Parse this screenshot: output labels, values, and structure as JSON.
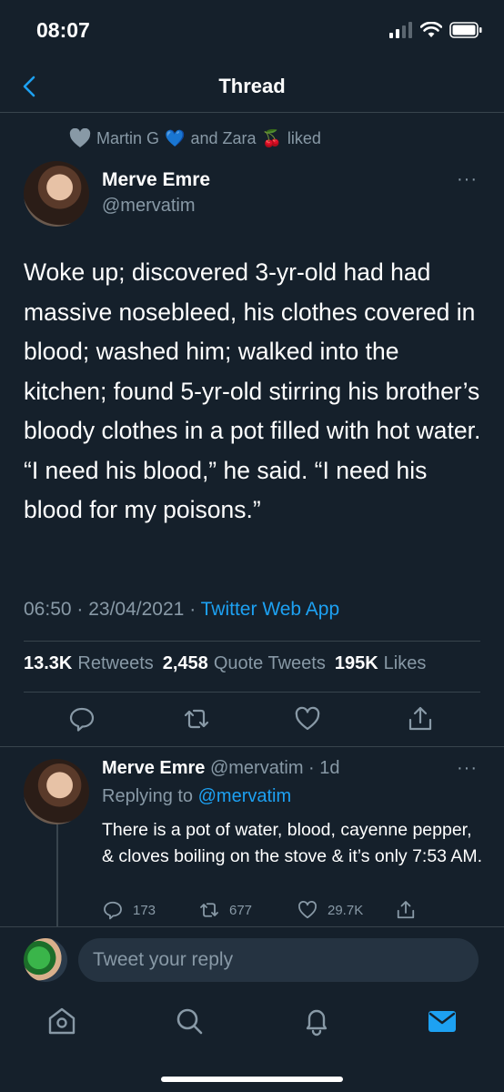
{
  "status_bar": {
    "time": "08:07"
  },
  "nav": {
    "title": "Thread"
  },
  "social_context": {
    "prefix": "Martin G",
    "emoji1": "💙",
    "middle": "and Zara",
    "emoji2": "🍒",
    "suffix": "liked"
  },
  "tweet": {
    "author_name": "Merve Emre",
    "author_handle": "@mervatim",
    "text": "Woke up; discovered 3-yr-old had had massive nosebleed, his clothes covered in blood; washed him; walked into the kitchen; found 5-yr-old stirring his brother’s bloody clothes in a pot filled with hot water. “I need his blood,” he said. “I need his blood for my poisons.”",
    "time": "06:50",
    "date": "23/04/2021",
    "source": "Twitter Web App",
    "retweets_count": "13.3K",
    "retweets_label": "Retweets",
    "quotes_count": "2,458",
    "quotes_label": "Quote Tweets",
    "likes_count": "195K",
    "likes_label": "Likes"
  },
  "reply": {
    "author_name": "Merve Emre",
    "author_handle": "@mervatim",
    "age": "1d",
    "replying_prefix": "Replying to",
    "replying_to": "@mervatim",
    "text": "There is a pot of water, blood, cayenne pepper, & cloves boiling on the stove & it’s only 7:53 AM.",
    "reply_count": "173",
    "retweet_count": "677",
    "like_count": "29.7K"
  },
  "compose": {
    "placeholder": "Tweet your reply"
  },
  "colors": {
    "background": "#15202b",
    "text_secondary": "#8899a6",
    "accent": "#1da1f2",
    "divider": "#38444d"
  },
  "icons": [
    "chevron-left-icon",
    "heart-icon",
    "more-icon",
    "reply-icon",
    "retweet-icon",
    "like-icon",
    "share-icon",
    "home-icon",
    "search-icon",
    "notifications-icon",
    "messages-icon"
  ]
}
